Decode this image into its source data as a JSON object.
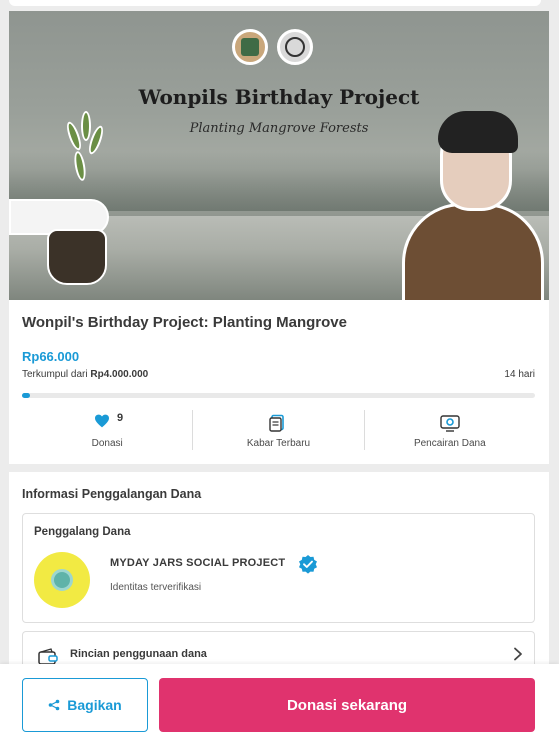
{
  "banner": {
    "title": "Wonpils Birthday Project",
    "subtitle": "Planting Mangrove Forests"
  },
  "campaign": {
    "title": "Wonpil's Birthday Project: Planting Mangrove",
    "amount": "Rp66.000",
    "raised_prefix": "Terkumpul dari",
    "target": "Rp4.000.000",
    "days_left": "14 hari",
    "progress_fraction": 0.0165
  },
  "stats": [
    {
      "label": "Donasi",
      "count": "9",
      "icon": "heart-icon"
    },
    {
      "label": "Kabar Terbaru",
      "icon": "document-icon"
    },
    {
      "label": "Pencairan Dana",
      "icon": "money-transfer-icon"
    }
  ],
  "info": {
    "section_title": "Informasi Penggalangan Dana",
    "fundraiser_label": "Penggalang Dana",
    "org_name": "MYDAY JARS SOCIAL PROJECT",
    "org_status": "Identitas terverifikasi",
    "detail_label": "Rincian penggunaan dana"
  },
  "actions": {
    "share_label": "Bagikan",
    "donate_label": "Donasi sekarang"
  },
  "colors": {
    "accent": "#1a9ad6",
    "donate": "#e0336e"
  }
}
